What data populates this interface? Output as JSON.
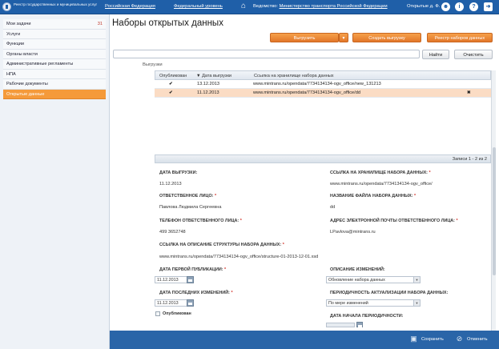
{
  "header": {
    "brand": "Реестр государственных и муниципальных услуг",
    "nav": [
      "Российская Федерация",
      "Федеральный уровень"
    ],
    "dept_label": "Ведомство:",
    "dept_value": "Министерство транспорта Российской Федерации",
    "user": "Открытые д. Ф.",
    "icons": [
      "home-icon",
      "user-icon",
      "info-icon",
      "help-icon",
      "exit-icon"
    ]
  },
  "sidebar": {
    "items": [
      {
        "label": "Мои задачи",
        "count": "31"
      },
      {
        "label": "Услуги"
      },
      {
        "label": "Функции"
      },
      {
        "label": "Органы власти"
      },
      {
        "label": "Административные регламенты"
      },
      {
        "label": "НПА"
      },
      {
        "label": "Рабочие документы"
      },
      {
        "label": "Открытые данные",
        "active": true
      }
    ]
  },
  "main": {
    "title": "Наборы открытых данных",
    "buttons": {
      "upload": "Выгрузить",
      "create_upload": "Создать выгрузку",
      "registry": "Реестр наборов данных"
    },
    "search": {
      "find": "Найти",
      "clear": "Очистить",
      "placeholder": ""
    },
    "section": "Выгрузки",
    "grid": {
      "columns": [
        "Опубликован",
        "Дата выгрузки",
        "Ссылка на хранилище набора данных"
      ],
      "rows": [
        {
          "published": true,
          "date": "13.12.2013",
          "link": "www.mintrans.ru/opendata/7734134134-ogv_office/new_131213",
          "selected": false
        },
        {
          "published": true,
          "date": "11.12.2013",
          "link": "www.mintrans.ru/opendata/7734134134-ogv_office/dd",
          "selected": true
        }
      ]
    },
    "pager": "Записи 1 - 2 из 2"
  },
  "form": {
    "date_upload_label": "ДАТА ВЫГРУЗКИ:",
    "date_upload_value": "11.12.2013",
    "storage_link_label": "ССЫЛКА НА ХРАНИЛИЩЕ НАБОРА ДАННЫХ:",
    "storage_link_value": "www.mintrans.ru/opendata/7734134134-ogv_office/",
    "resp_person_label": "ОТВЕТСТВЕННОЕ ЛИЦО:",
    "resp_person_value": "Павлова Людмила Сергеевна",
    "file_name_label": "НАЗВАНИЕ ФАЙЛА НАБОРА ДАННЫХ:",
    "file_name_value": "dd",
    "phone_label": "ТЕЛЕФОН ОТВЕТСТВЕННОГО ЛИЦА:",
    "phone_value": "499 3652748",
    "email_label": "АДРЕС ЭЛЕКТРОННОЙ ПОЧТЫ ОТВЕТСТВЕННОГО ЛИЦА:",
    "email_value": "LPavlova@mintrans.ru",
    "structure_label": "ССЫЛКА НА ОПИСАНИЕ СТРУКТУРЫ НАБОРА ДАННЫХ:",
    "structure_value": "www.mintrans.ru/opendata/7734134134-ogv_office/structure-01-2013-12-01.xsd",
    "first_pub_label": "ДАТА ПЕРВОЙ ПУБЛИКАЦИИ:",
    "first_pub_value": "11.12.2013",
    "changes_desc_label": "ОПИСАНИЕ ИЗМЕНЕНИЙ:",
    "changes_desc_value": "Обновление набора данных",
    "last_change_label": "ДАТА ПОСЛЕДНИХ ИЗМЕНЕНИЙ:",
    "last_change_value": "11.12.2013",
    "periodicity_label": "ПЕРИОДИЧНОСТЬ АКТУАЛИЗАЦИИ НАБОРА ДАННЫХ:",
    "periodicity_value": "По мере изменений",
    "published_label": "Опубликован",
    "period_start_label": "ДАТА НАЧАЛА ПЕРИОДИЧНОСТИ:",
    "req_mark": "*"
  },
  "footer": {
    "save": "Сохранить",
    "cancel": "Отменить"
  }
}
